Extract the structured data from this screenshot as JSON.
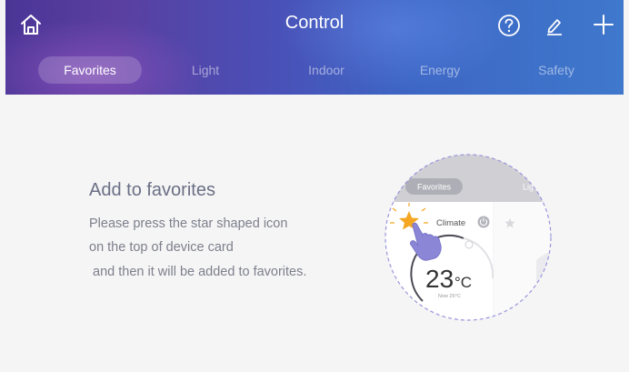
{
  "header": {
    "title": "Control",
    "icons": {
      "home": "home-icon",
      "help": "help-icon",
      "edit": "pencil-icon",
      "add": "plus-icon"
    }
  },
  "tabs": [
    {
      "label": "Favorites",
      "active": true
    },
    {
      "label": "Light",
      "active": false
    },
    {
      "label": "Indoor",
      "active": false
    },
    {
      "label": "Energy",
      "active": false
    },
    {
      "label": "Safety",
      "active": false
    }
  ],
  "hint": {
    "title": "Add to favorites",
    "lines": [
      "Please press the star shaped icon",
      "on the top of device card",
      " and then it will be added to favorites."
    ]
  },
  "illustration": {
    "tab_active": "Favorites",
    "tab_next": "Lig",
    "device_name": "Climate",
    "temperature": "23",
    "unit": "°C",
    "subtext": "Now 26°C",
    "colors": {
      "star": "#f5a623",
      "accent": "#8b86d6"
    }
  }
}
